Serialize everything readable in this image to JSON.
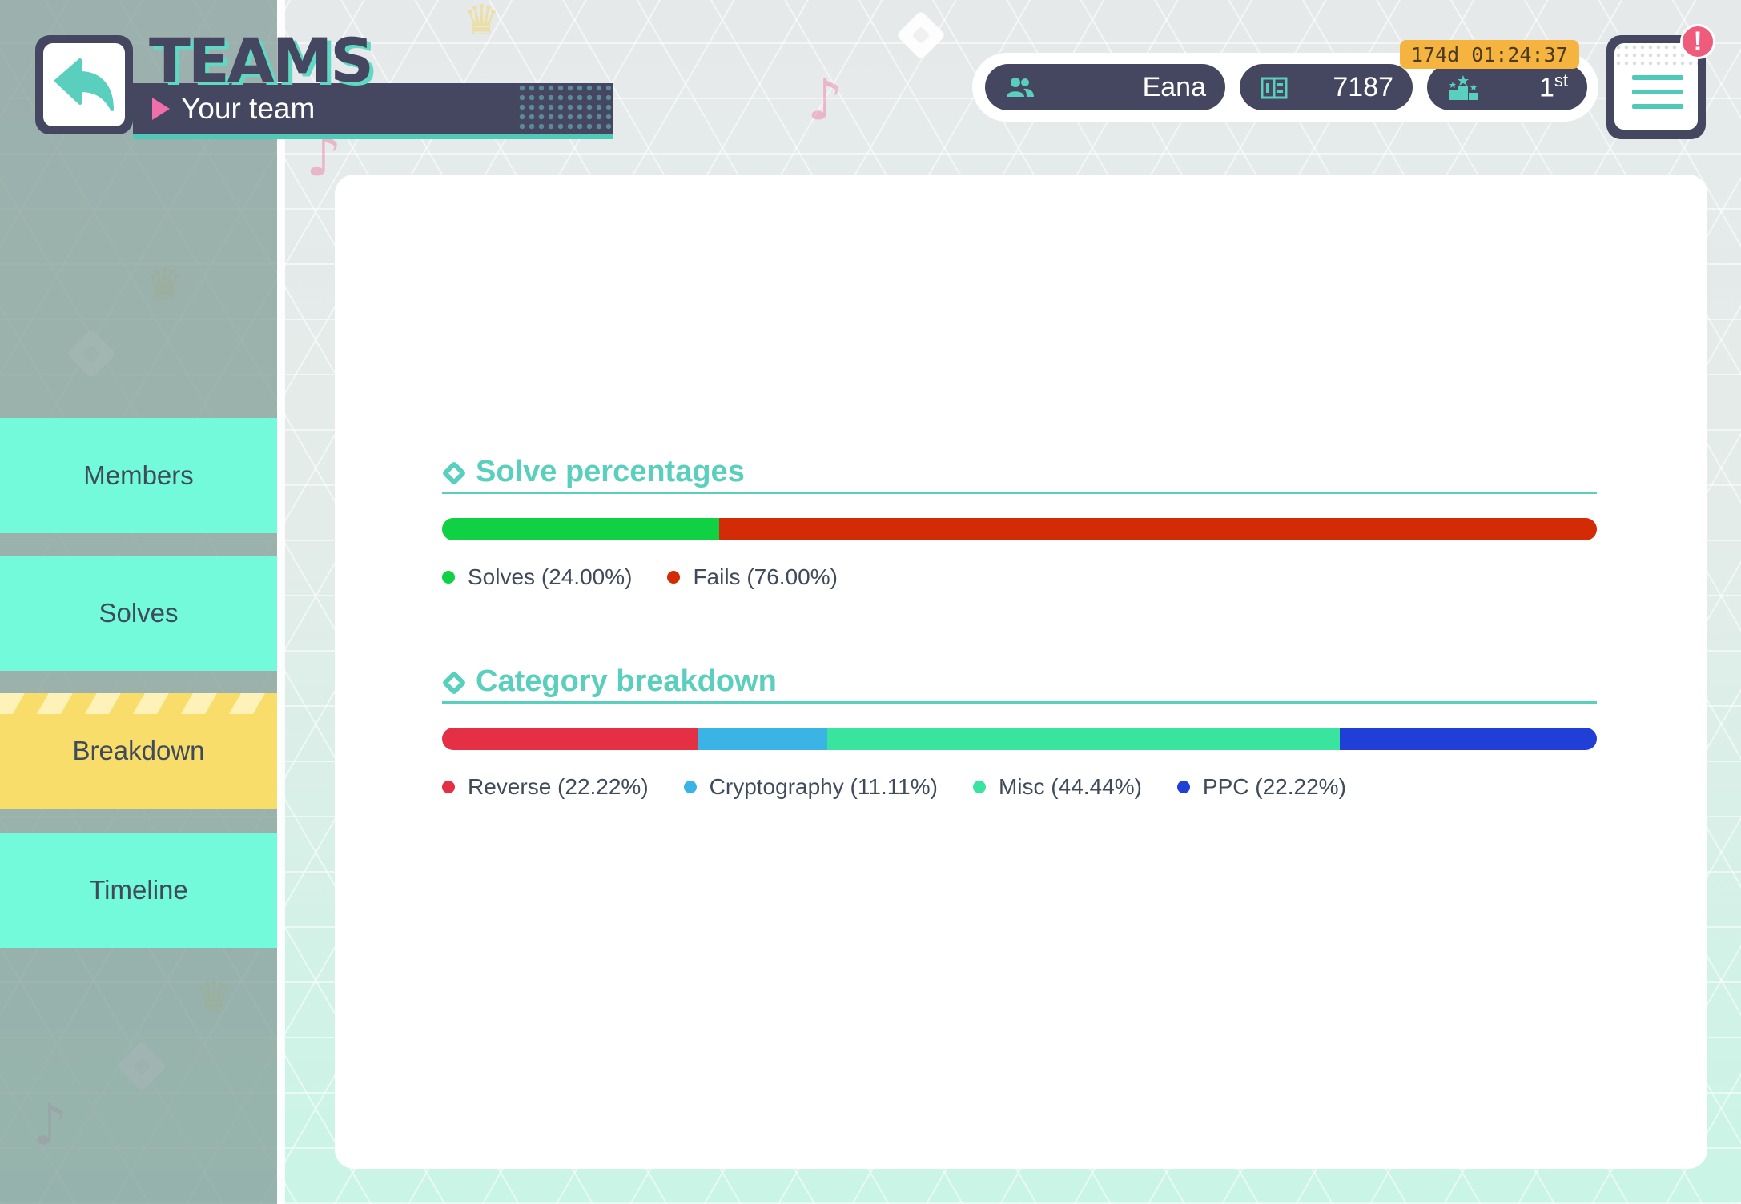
{
  "header": {
    "title": "TEAMS",
    "subtitle": "Your team"
  },
  "status": {
    "timer": "174d 01:24:37",
    "username": "Eana",
    "score": "7187",
    "rank": "1",
    "rank_suffix": "st",
    "alert": "!"
  },
  "sidebar": {
    "items": [
      {
        "label": "Members",
        "active": false
      },
      {
        "label": "Solves",
        "active": false
      },
      {
        "label": "Breakdown",
        "active": true
      },
      {
        "label": "Timeline",
        "active": false
      }
    ]
  },
  "solve_percentages": {
    "title": "Solve percentages",
    "segments": [
      {
        "label": "Solves (24.00%)",
        "percent": 24.0,
        "color": "#0fd143"
      },
      {
        "label": "Fails (76.00%)",
        "percent": 76.0,
        "color": "#d32b06"
      }
    ]
  },
  "category_breakdown": {
    "title": "Category breakdown",
    "segments": [
      {
        "label": "Reverse (22.22%)",
        "percent": 22.22,
        "color": "#e52f45"
      },
      {
        "label": "Cryptography (11.11%)",
        "percent": 11.11,
        "color": "#3ab4e5"
      },
      {
        "label": "Misc (44.44%)",
        "percent": 44.44,
        "color": "#39e59e"
      },
      {
        "label": "PPC (22.22%)",
        "percent": 22.22,
        "color": "#1f3fd6"
      }
    ]
  },
  "colors": {
    "accent": "#5bcfbd",
    "nav": "#72fadb",
    "nav_active": "#f8dd6b",
    "dark": "#454660"
  }
}
